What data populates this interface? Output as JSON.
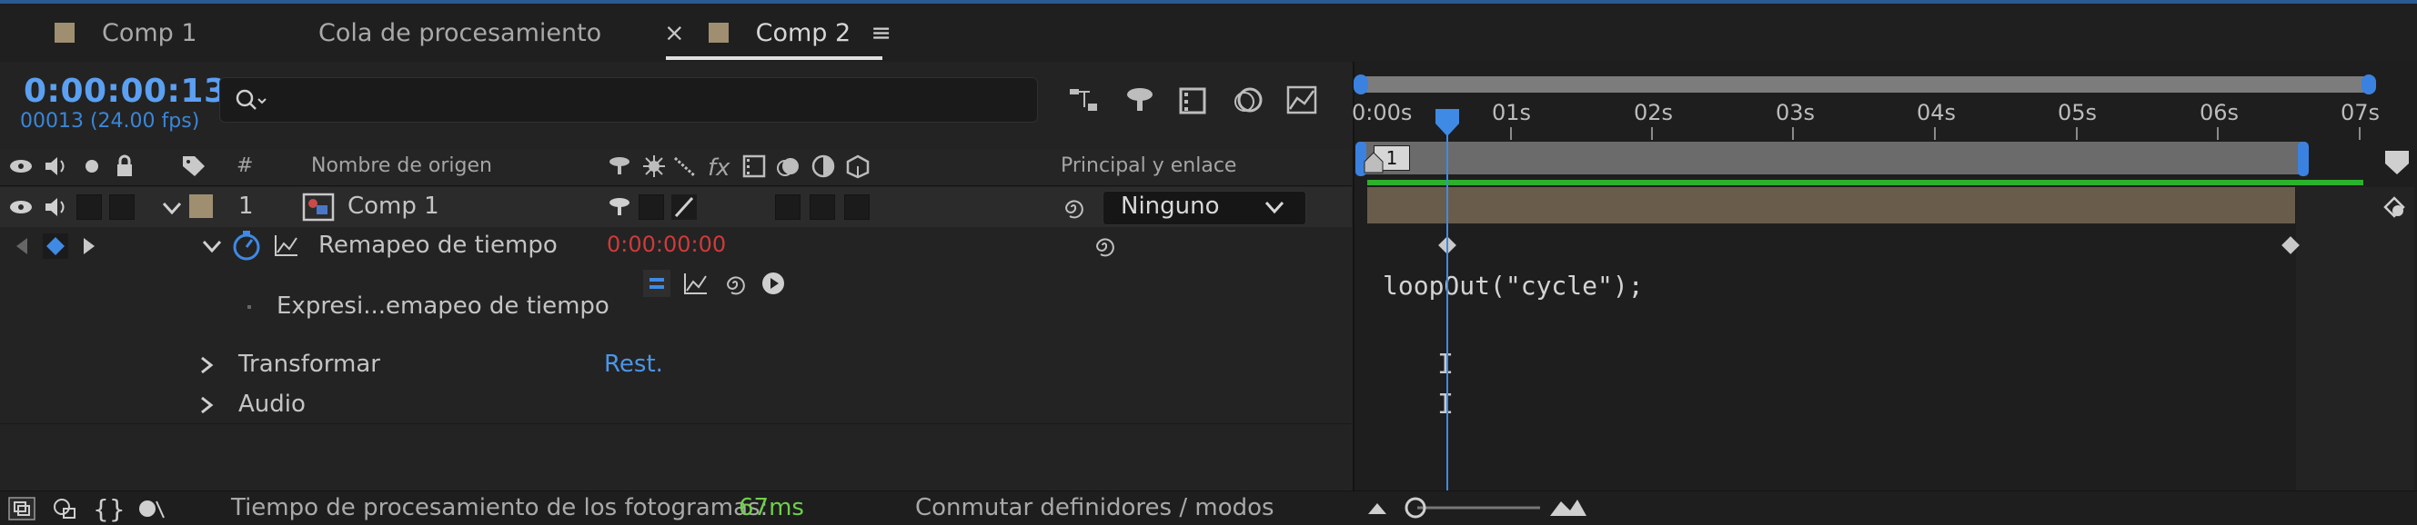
{
  "tabs": [
    {
      "label": "Comp 1",
      "active": false,
      "has_close": false
    },
    {
      "label": "Cola de procesamiento",
      "active": false,
      "has_close": false
    },
    {
      "label": "Comp 2",
      "active": true,
      "has_close": true
    }
  ],
  "tab_close_glyph": "×",
  "tab_menu_glyph": "≡",
  "composition": {
    "timecode": "0:00:00:13",
    "frames_fps": "00013 (24.00 fps)",
    "search_placeholder": ""
  },
  "columns": {
    "number": "#",
    "source_name": "Nombre de origen",
    "parent_link": "Principal y enlace"
  },
  "layer": {
    "index": "1",
    "name": "Comp 1",
    "parent_value": "Ninguno"
  },
  "properties": {
    "time_remap": {
      "label": "Remapeo de tiempo",
      "value": "0:00:00:00"
    },
    "expression": {
      "label": "Expresi...emapeo de tiempo",
      "code": "loopOut(\"cycle\");"
    },
    "transform": {
      "label": "Transformar",
      "reset_label": "Rest."
    },
    "audio": {
      "label": "Audio"
    }
  },
  "ruler": {
    "labels": [
      "0:00s",
      "01s",
      "02s",
      "03s",
      "04s",
      "05s",
      "06s",
      "07s"
    ],
    "marker_label": "1"
  },
  "statusbar": {
    "frame_time_label": "Tiempo de procesamiento de los fotogramas:",
    "frame_time_value": "67ms",
    "toggle_label": "Conmutar definidores / modos"
  },
  "colors": {
    "accent": "#3f8ae4",
    "timecode": "#5ba0f2",
    "red_value": "#d03a3a",
    "layer_bar": "#6a5c4b",
    "label_swatch": "#a08e71",
    "frame_time_green": "#6fcf4a"
  }
}
